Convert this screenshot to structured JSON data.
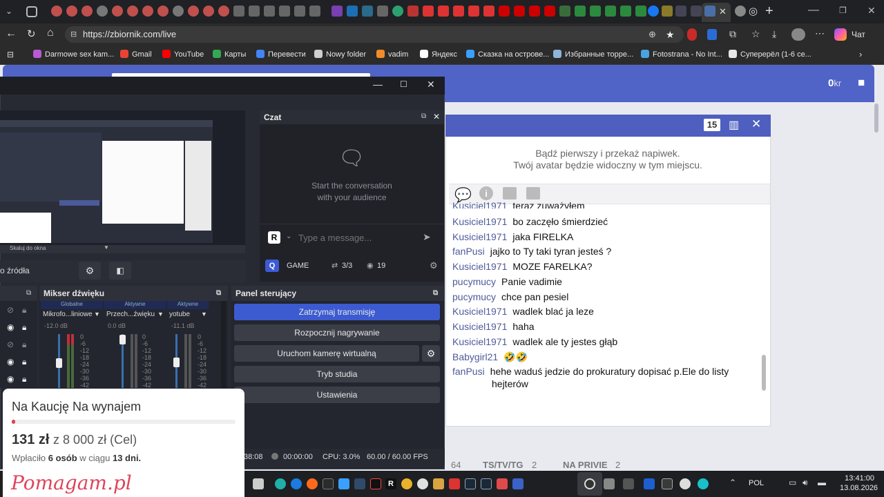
{
  "browser": {
    "url": "https://zbiornik.com/live",
    "chat_label": "Чат",
    "bookmarks": [
      {
        "label": "Darmowe sex kam...",
        "color": "#b85ad6"
      },
      {
        "label": "Gmail",
        "color": "#ea4335"
      },
      {
        "label": "YouTube",
        "color": "#ff0000"
      },
      {
        "label": "Карты",
        "color": "#34a853"
      },
      {
        "label": "Перевести",
        "color": "#4285f4"
      },
      {
        "label": "Nowy folder",
        "color": "#cfcfcf"
      },
      {
        "label": "vadim",
        "color": "#f28c28"
      },
      {
        "label": "Яндекс",
        "color": "#ffffff"
      },
      {
        "label": "Сказка на острове...",
        "color": "#3aa0ff"
      },
      {
        "label": "Избранные торре...",
        "color": "#8fb3d9"
      },
      {
        "label": "Fotostrana - No Int...",
        "color": "#4aa3df"
      },
      {
        "label": "Суперерёл (1-6 се...",
        "color": "#e8e8e8"
      }
    ]
  },
  "site": {
    "balance": "0",
    "currency": "kr",
    "chat_count": "15",
    "tip_line1": "Bądź pierwszy i przekaż napiwek.",
    "tip_line2": "Twój avatar będzie widoczny w tym miejscu.",
    "messages": [
      {
        "user": "Kusiciel1971",
        "text": "teraz zuważyłem"
      },
      {
        "user": "Kusiciel1971",
        "text": "bo zaczęło śmierdzieć"
      },
      {
        "user": "Kusiciel1971",
        "text": "jaka FIRELKA"
      },
      {
        "user": "fanPusi",
        "text": "jajko to Ty taki tyran jesteś ?"
      },
      {
        "user": "Kusiciel1971",
        "text": "MOZE FARELKA?"
      },
      {
        "user": "pucymucy",
        "text": "Panie vadimie"
      },
      {
        "user": "pucymucy",
        "text": "chce pan pesiel"
      },
      {
        "user": "Kusiciel1971",
        "text": "wadlek blać ja leze"
      },
      {
        "user": "Kusiciel1971",
        "text": "haha"
      },
      {
        "user": "Kusiciel1971",
        "text": "wadlek ale ty jestes głąb"
      },
      {
        "user": "Babygirl21",
        "text": "🤣🤣"
      },
      {
        "user": "fanPusi",
        "text": "hehe waduś jedzie do prokuratury dopisać p.Ele do listy"
      },
      {
        "user": "",
        "text": "hejterów"
      }
    ],
    "bottom_tabs": [
      "64",
      "TS/TV/TG",
      "2",
      "NA PRIVIE",
      "2"
    ]
  },
  "obs": {
    "chat_title": "Czat",
    "chat_empty_1": "Start the conversation",
    "chat_empty_2": "with your audience",
    "message_placeholder": "Type a message...",
    "game_label": "GAME",
    "viewers_ratio": "3/3",
    "viewer_count": "19",
    "preview_scale": "Skaluj do okna",
    "sources_label": "o źródła",
    "mixer_title": "Mikser dźwięku",
    "controls_title": "Panel sterujący",
    "mixer_cols": [
      {
        "state": "Globalne",
        "name": "Mikrofo...liniowe",
        "db": "-12.0 dB"
      },
      {
        "state": "Aktywne",
        "name": "Przech...źwięku",
        "db": "0.0 dB"
      },
      {
        "state": "Aktywne",
        "name": "yotube",
        "db": "-11.1 dB"
      }
    ],
    "ticks": [
      "0",
      "-6",
      "-12",
      "-18",
      "-24",
      "-30",
      "-36",
      "-42"
    ],
    "buttons": {
      "stop_stream": "Zatrzymaj transmisję",
      "start_record": "Rozpocznij nagrywanie",
      "virtual_cam": "Uruchom kamerę wirtualną",
      "studio_mode": "Tryb studia",
      "settings": "Ustawienia"
    },
    "status": {
      "time1": "38:08",
      "time2": "00:00:00",
      "cpu": "CPU: 3.0%",
      "fps": "60.00 / 60.00 FPS"
    }
  },
  "card": {
    "title": "Na Kaucję Na wynajem",
    "amount": "131 zł",
    "goal": "z 8 000 zł (Cel)",
    "progress": 0.016,
    "donors_pre": "Wpłaciło",
    "donors": "6 osób",
    "days_pre": "w ciągu",
    "days": "13 dni.",
    "logo": "Pomagam.pl"
  },
  "taskbar": {
    "lang": "POL",
    "time": "13:41:00",
    "date": "13.08.2026"
  }
}
